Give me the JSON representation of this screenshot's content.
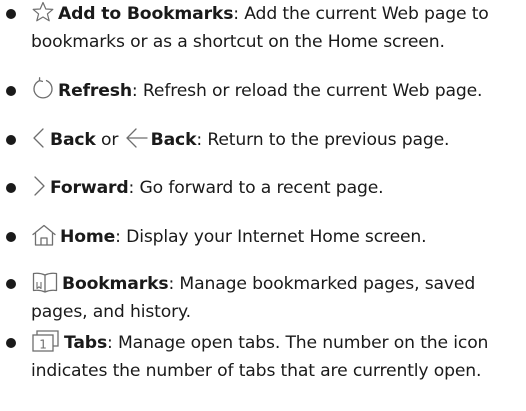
{
  "items": [
    {
      "icon": "star-outline-icon",
      "term": "Add to Bookmarks",
      "desc": ": Add the current Web page to bookmarks or as a shortcut on the Home screen."
    },
    {
      "icon": "refresh-icon",
      "term": "Refresh",
      "desc": ": Refresh or reload the current Web page."
    },
    {
      "icon": "chevron-left-icon",
      "term": "Back",
      "or": " or ",
      "icon2": "arrow-left-icon",
      "term2": "Back",
      "desc": ": Return to the previous page."
    },
    {
      "icon": "chevron-right-icon",
      "term": "Forward",
      "desc": ": Go forward to a recent page."
    },
    {
      "icon": "home-icon",
      "term": "Home",
      "desc": ": Display your Internet Home screen."
    },
    {
      "icon": "book-icon",
      "term": "Bookmarks",
      "desc": ": Manage bookmarked pages, saved pages, and history."
    },
    {
      "icon": "tabs-icon",
      "icon_number": "1",
      "term": "Tabs",
      "desc": ": Manage open tabs. The number on the icon indicates the number of tabs that are currently open."
    }
  ]
}
